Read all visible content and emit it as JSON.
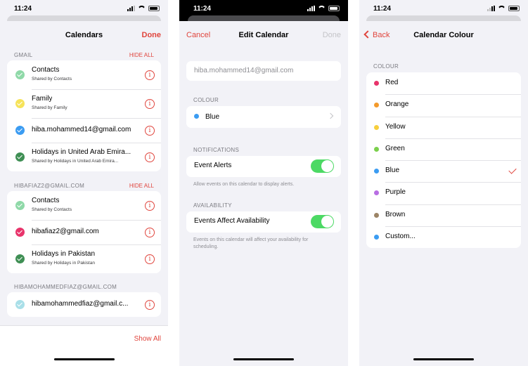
{
  "status_time": "11:24",
  "colors": {
    "accent": "#e0453d",
    "toggle_on": "#4cd964"
  },
  "screen1": {
    "title": "Calendars",
    "done": "Done",
    "sections": [
      {
        "label": "GMAIL",
        "hide_all": "HIDE ALL",
        "items": [
          {
            "title": "Contacts",
            "subtitle": "Shared by Contacts",
            "color": "#8fd9a8"
          },
          {
            "title": "Family",
            "subtitle": "Shared by Family",
            "color": "#f6e35a"
          },
          {
            "title": "hiba.mohammed14@gmail.com",
            "subtitle": "",
            "color": "#3b9cf2"
          },
          {
            "title": "Holidays in United Arab Emira...",
            "subtitle": "Shared by Holidays in United Arab Emira...",
            "color": "#3f8f54"
          }
        ]
      },
      {
        "label": "HIBAFIAZ2@GMAIL.COM",
        "hide_all": "HIDE ALL",
        "items": [
          {
            "title": "Contacts",
            "subtitle": "Shared by Contacts",
            "color": "#8fd9a8"
          },
          {
            "title": "hibafiaz2@gmail.com",
            "subtitle": "",
            "color": "#e8346b"
          },
          {
            "title": "Holidays in Pakistan",
            "subtitle": "Shared by Holidays in Pakistan",
            "color": "#3f8f54"
          }
        ]
      },
      {
        "label": "HIBAMOHAMMEDFIAZ@GMAIL.COM",
        "hide_all": "",
        "items": [
          {
            "title": "hibamohammedfiaz@gmail.c...",
            "subtitle": "",
            "color": "#a9dfe8"
          }
        ]
      }
    ],
    "show_all": "Show All"
  },
  "screen2": {
    "cancel": "Cancel",
    "title": "Edit Calendar",
    "done": "Done",
    "name_value": "hiba.mohammed14@gmail.com",
    "colour_label": "COLOUR",
    "colour_value": "Blue",
    "colour_dot": "#3b9cf2",
    "notifications_label": "NOTIFICATIONS",
    "event_alerts": "Event Alerts",
    "event_alerts_on": true,
    "event_alerts_note": "Allow events on this calendar to display alerts.",
    "availability_label": "AVAILABILITY",
    "events_affect": "Events Affect Availability",
    "events_affect_on": true,
    "events_affect_note": "Events on this calendar will affect your availability for scheduling."
  },
  "screen3": {
    "back": "Back",
    "title": "Calendar Colour",
    "section_label": "COLOUR",
    "selected": "Blue",
    "options": [
      {
        "name": "Red",
        "color": "#e8346b"
      },
      {
        "name": "Orange",
        "color": "#f39a2b"
      },
      {
        "name": "Yellow",
        "color": "#f7cf3c"
      },
      {
        "name": "Green",
        "color": "#7bd04c"
      },
      {
        "name": "Blue",
        "color": "#3b9cf2"
      },
      {
        "name": "Purple",
        "color": "#b86ee3"
      },
      {
        "name": "Brown",
        "color": "#9c8466"
      },
      {
        "name": "Custom...",
        "color": "#3b9cf2"
      }
    ]
  }
}
